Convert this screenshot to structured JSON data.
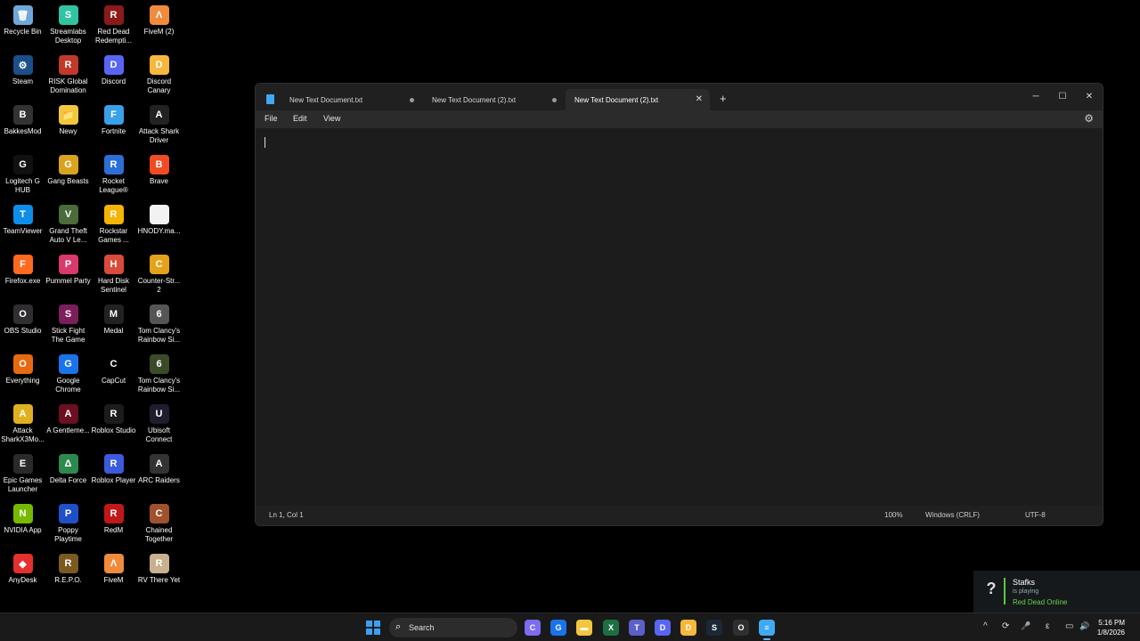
{
  "desktop": {
    "icons": [
      {
        "label": "Recycle Bin",
        "color": "#6fa8d8",
        "glyph": "🗑"
      },
      {
        "label": "Streamlabs Desktop",
        "color": "#31c3a2",
        "glyph": "S"
      },
      {
        "label": "Red Dead Redempti...",
        "color": "#8b1a1a",
        "glyph": "R"
      },
      {
        "label": "FiveM (2)",
        "color": "#f08a3c",
        "glyph": "Λ"
      },
      {
        "label": "Steam",
        "color": "#1b4f8a",
        "glyph": "⚙"
      },
      {
        "label": "RISK Global Domination",
        "color": "#c0392b",
        "glyph": "R"
      },
      {
        "label": "Discord",
        "color": "#5865f2",
        "glyph": "D"
      },
      {
        "label": "Discord Canary",
        "color": "#f6b73c",
        "glyph": "D"
      },
      {
        "label": "BakkesMod",
        "color": "#333333",
        "glyph": "B"
      },
      {
        "label": "Newy",
        "color": "#f3c640",
        "glyph": "📁"
      },
      {
        "label": "Fortnite",
        "color": "#3aa0e8",
        "glyph": "F"
      },
      {
        "label": "Attack Shark Driver",
        "color": "#222222",
        "glyph": "A"
      },
      {
        "label": "Logitech G HUB",
        "color": "#111111",
        "glyph": "G"
      },
      {
        "label": "Gang Beasts",
        "color": "#d9a320",
        "glyph": "G"
      },
      {
        "label": "Rocket League®",
        "color": "#2b6fd6",
        "glyph": "R"
      },
      {
        "label": "Brave",
        "color": "#f04b23",
        "glyph": "B"
      },
      {
        "label": "TeamViewer",
        "color": "#0e8ee9",
        "glyph": "T"
      },
      {
        "label": "Grand Theft Auto V Le...",
        "color": "#4a6b3a",
        "glyph": "V"
      },
      {
        "label": "Rockstar Games ...",
        "color": "#f5b400",
        "glyph": "R"
      },
      {
        "label": "HNODY.ma...",
        "color": "#f2f2f2",
        "glyph": ""
      },
      {
        "label": "Firefox.exe",
        "color": "#ff6a1f",
        "glyph": "F"
      },
      {
        "label": "Pummel Party",
        "color": "#d83a6b",
        "glyph": "P"
      },
      {
        "label": "Hard Disk Sentinel",
        "color": "#d94b3a",
        "glyph": "H"
      },
      {
        "label": "Counter-Str... 2",
        "color": "#e3a21a",
        "glyph": "C"
      },
      {
        "label": "OBS Studio",
        "color": "#302e31",
        "glyph": "O"
      },
      {
        "label": "Stick Fight The Game",
        "color": "#7a1f5c",
        "glyph": "S"
      },
      {
        "label": "Medal",
        "color": "#222222",
        "glyph": "M"
      },
      {
        "label": "Tom Clancy's Rainbow Si...",
        "color": "#555555",
        "glyph": "6"
      },
      {
        "label": "Everything",
        "color": "#e86a10",
        "glyph": "O"
      },
      {
        "label": "Google Chrome",
        "color": "#1a73e8",
        "glyph": "G"
      },
      {
        "label": "CapCut",
        "color": "#000000",
        "glyph": "C"
      },
      {
        "label": "Tom Clancy's Rainbow Si...",
        "color": "#3c4a2a",
        "glyph": "6"
      },
      {
        "label": "Attack SharkX3Mo...",
        "color": "#e0b020",
        "glyph": "A"
      },
      {
        "label": "A Gentleme...",
        "color": "#6a1020",
        "glyph": "A"
      },
      {
        "label": "Roblox Studio",
        "color": "#1c1c1c",
        "glyph": "R"
      },
      {
        "label": "Ubisoft Connect",
        "color": "#1e1e2e",
        "glyph": "U"
      },
      {
        "label": "Epic Games Launcher",
        "color": "#2a2a2a",
        "glyph": "E"
      },
      {
        "label": "Delta Force",
        "color": "#2d8a4e",
        "glyph": "Δ"
      },
      {
        "label": "Roblox Player",
        "color": "#3b5bdb",
        "glyph": "R"
      },
      {
        "label": "ARC Raiders",
        "color": "#333333",
        "glyph": "A"
      },
      {
        "label": "NVIDIA App",
        "color": "#76b900",
        "glyph": "N"
      },
      {
        "label": "Poppy Playtime",
        "color": "#2050c8",
        "glyph": "P"
      },
      {
        "label": "RedM",
        "color": "#c01818",
        "glyph": "R"
      },
      {
        "label": "Chained Together",
        "color": "#a0522d",
        "glyph": "C"
      },
      {
        "label": "AnyDesk",
        "color": "#e5302d",
        "glyph": "◆"
      },
      {
        "label": "R.E.P.O.",
        "color": "#7a5a20",
        "glyph": "R"
      },
      {
        "label": "FiveM",
        "color": "#f08a3c",
        "glyph": "Λ"
      },
      {
        "label": "RV There Yet",
        "color": "#c8b090",
        "glyph": "R"
      }
    ]
  },
  "notepad": {
    "tabs": [
      {
        "label": "New Text Document.txt",
        "state": "unsaved"
      },
      {
        "label": "New Text Document (2).txt",
        "state": "unsaved"
      },
      {
        "label": "New Text Document (2).txt",
        "state": "active"
      }
    ],
    "new_tab": "+",
    "controls": {
      "minimize": "─",
      "maximize": "☐",
      "close": "✕"
    },
    "menu": {
      "file": "File",
      "edit": "Edit",
      "view": "View"
    },
    "settings_icon": "⚙",
    "content": "",
    "status": {
      "position": "Ln 1, Col 1",
      "zoom": "100%",
      "line_ending": "Windows (CRLF)",
      "encoding": "UTF-8"
    }
  },
  "notification": {
    "icon": "?",
    "name": "Stafks",
    "status": "is playing",
    "game": "Red Dead Online",
    "accent": "#5dc840"
  },
  "taskbar": {
    "search_label": "Search",
    "apps": [
      {
        "name": "copilot",
        "color": "#7b6cf0",
        "glyph": "C"
      },
      {
        "name": "chrome",
        "color": "#1a73e8",
        "glyph": "G"
      },
      {
        "name": "file-explorer",
        "color": "#f3c640",
        "glyph": "▬"
      },
      {
        "name": "excel",
        "color": "#1d6f42",
        "glyph": "X"
      },
      {
        "name": "teams",
        "color": "#5b5fc7",
        "glyph": "T"
      },
      {
        "name": "discord",
        "color": "#5865f2",
        "glyph": "D"
      },
      {
        "name": "discord-canary",
        "color": "#f6b73c",
        "glyph": "D"
      },
      {
        "name": "steam",
        "color": "#1b2838",
        "glyph": "S"
      },
      {
        "name": "obs",
        "color": "#302e31",
        "glyph": "O"
      },
      {
        "name": "notepad",
        "color": "#3fa9f5",
        "glyph": "≡"
      }
    ],
    "tray": {
      "chevron": "^",
      "sync": "⟳",
      "mic": "🎤",
      "lang": "ε",
      "network": "▭",
      "volume": "🔊"
    },
    "time": "5:16 PM",
    "date": "1/8/2026"
  }
}
